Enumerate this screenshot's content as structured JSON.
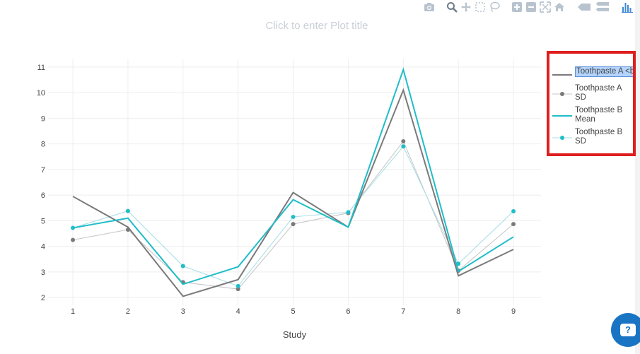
{
  "modebar": {
    "icons": [
      "camera-icon",
      "zoom-icon",
      "pan-icon",
      "box-select-icon",
      "lasso-icon",
      "zoom-in-icon",
      "zoom-out-icon",
      "autoscale-icon",
      "reset-axes-icon",
      "hover-closest-icon",
      "hover-compare-icon",
      "plotly-logo-icon"
    ]
  },
  "plot": {
    "title_placeholder": "Click to enter Plot title",
    "xlabel": "Study"
  },
  "legend": {
    "items": [
      {
        "label": "Toothpaste A <br",
        "editing": true
      },
      {
        "label": "Toothpaste A\n SD",
        "editing": false
      },
      {
        "label": "Toothpaste B\n Mean",
        "editing": false
      },
      {
        "label": "Toothpaste B\n SD",
        "editing": false
      }
    ]
  },
  "colors": {
    "series_a": "#7a7a7a",
    "series_b": "#1fbdc8",
    "highlight": "#e01e1e",
    "help": "#1a74c4"
  },
  "chart_data": {
    "type": "line",
    "x": [
      1,
      2,
      3,
      4,
      5,
      6,
      7,
      8,
      9
    ],
    "xlabel": "Study",
    "ylabel": "",
    "ylim": [
      1.7,
      11.3
    ],
    "yticks": [
      2,
      3,
      4,
      5,
      6,
      7,
      8,
      9,
      10,
      11
    ],
    "grid": true,
    "legend_position": "right",
    "series": [
      {
        "name": "Toothpaste A <br",
        "style": "line",
        "color": "#7a7a7a",
        "width": 2,
        "values": [
          5.95,
          4.75,
          2.05,
          2.7,
          6.1,
          4.75,
          10.1,
          2.85,
          3.88
        ]
      },
      {
        "name": "Toothpaste A SD",
        "style": "markers",
        "color": "#7a7a7a",
        "line_color": "#c4c4c4",
        "values": [
          4.25,
          4.65,
          2.6,
          2.33,
          4.87,
          5.3,
          8.1,
          3.05,
          4.87
        ]
      },
      {
        "name": "Toothpaste B Mean",
        "style": "line",
        "color": "#1fbdc8",
        "width": 2,
        "values": [
          4.72,
          5.1,
          2.52,
          3.2,
          5.82,
          4.75,
          10.9,
          3.02,
          4.37
        ]
      },
      {
        "name": "Toothpaste B SD",
        "style": "markers",
        "color": "#1fbdc8",
        "line_color": "#a5dde4",
        "values": [
          4.72,
          5.38,
          3.23,
          2.45,
          5.15,
          5.33,
          7.9,
          3.32,
          5.37
        ]
      }
    ]
  },
  "help": {
    "label": "?"
  }
}
